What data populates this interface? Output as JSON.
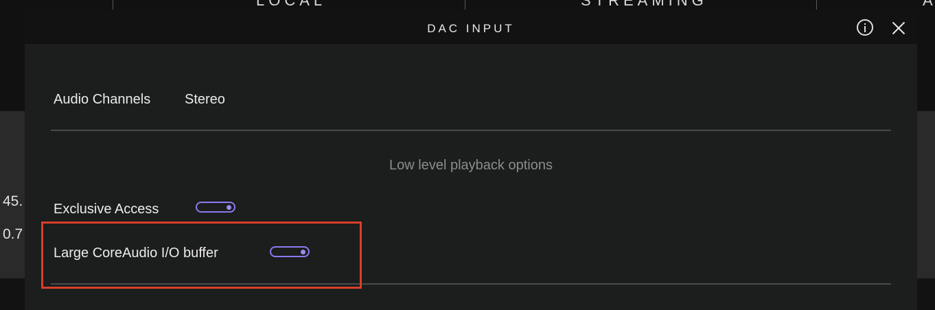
{
  "top_tabs": [
    {
      "label": "LOCAL"
    },
    {
      "label": "STREAMING"
    },
    {
      "label": "A"
    }
  ],
  "side_values": [
    "45.",
    "0.7"
  ],
  "dialog": {
    "title": "DAC INPUT",
    "info_icon": "info-icon",
    "close_icon": "close-icon",
    "audio_channels": {
      "label": "Audio Channels",
      "value": "Stereo"
    },
    "section_title": "Low level playback options",
    "options": [
      {
        "label": "Exclusive Access",
        "enabled": true
      },
      {
        "label": "Large CoreAudio I/O buffer",
        "enabled": true
      }
    ]
  },
  "colors": {
    "toggle_accent": "#8a7cf0",
    "highlight": "#d9402a"
  }
}
